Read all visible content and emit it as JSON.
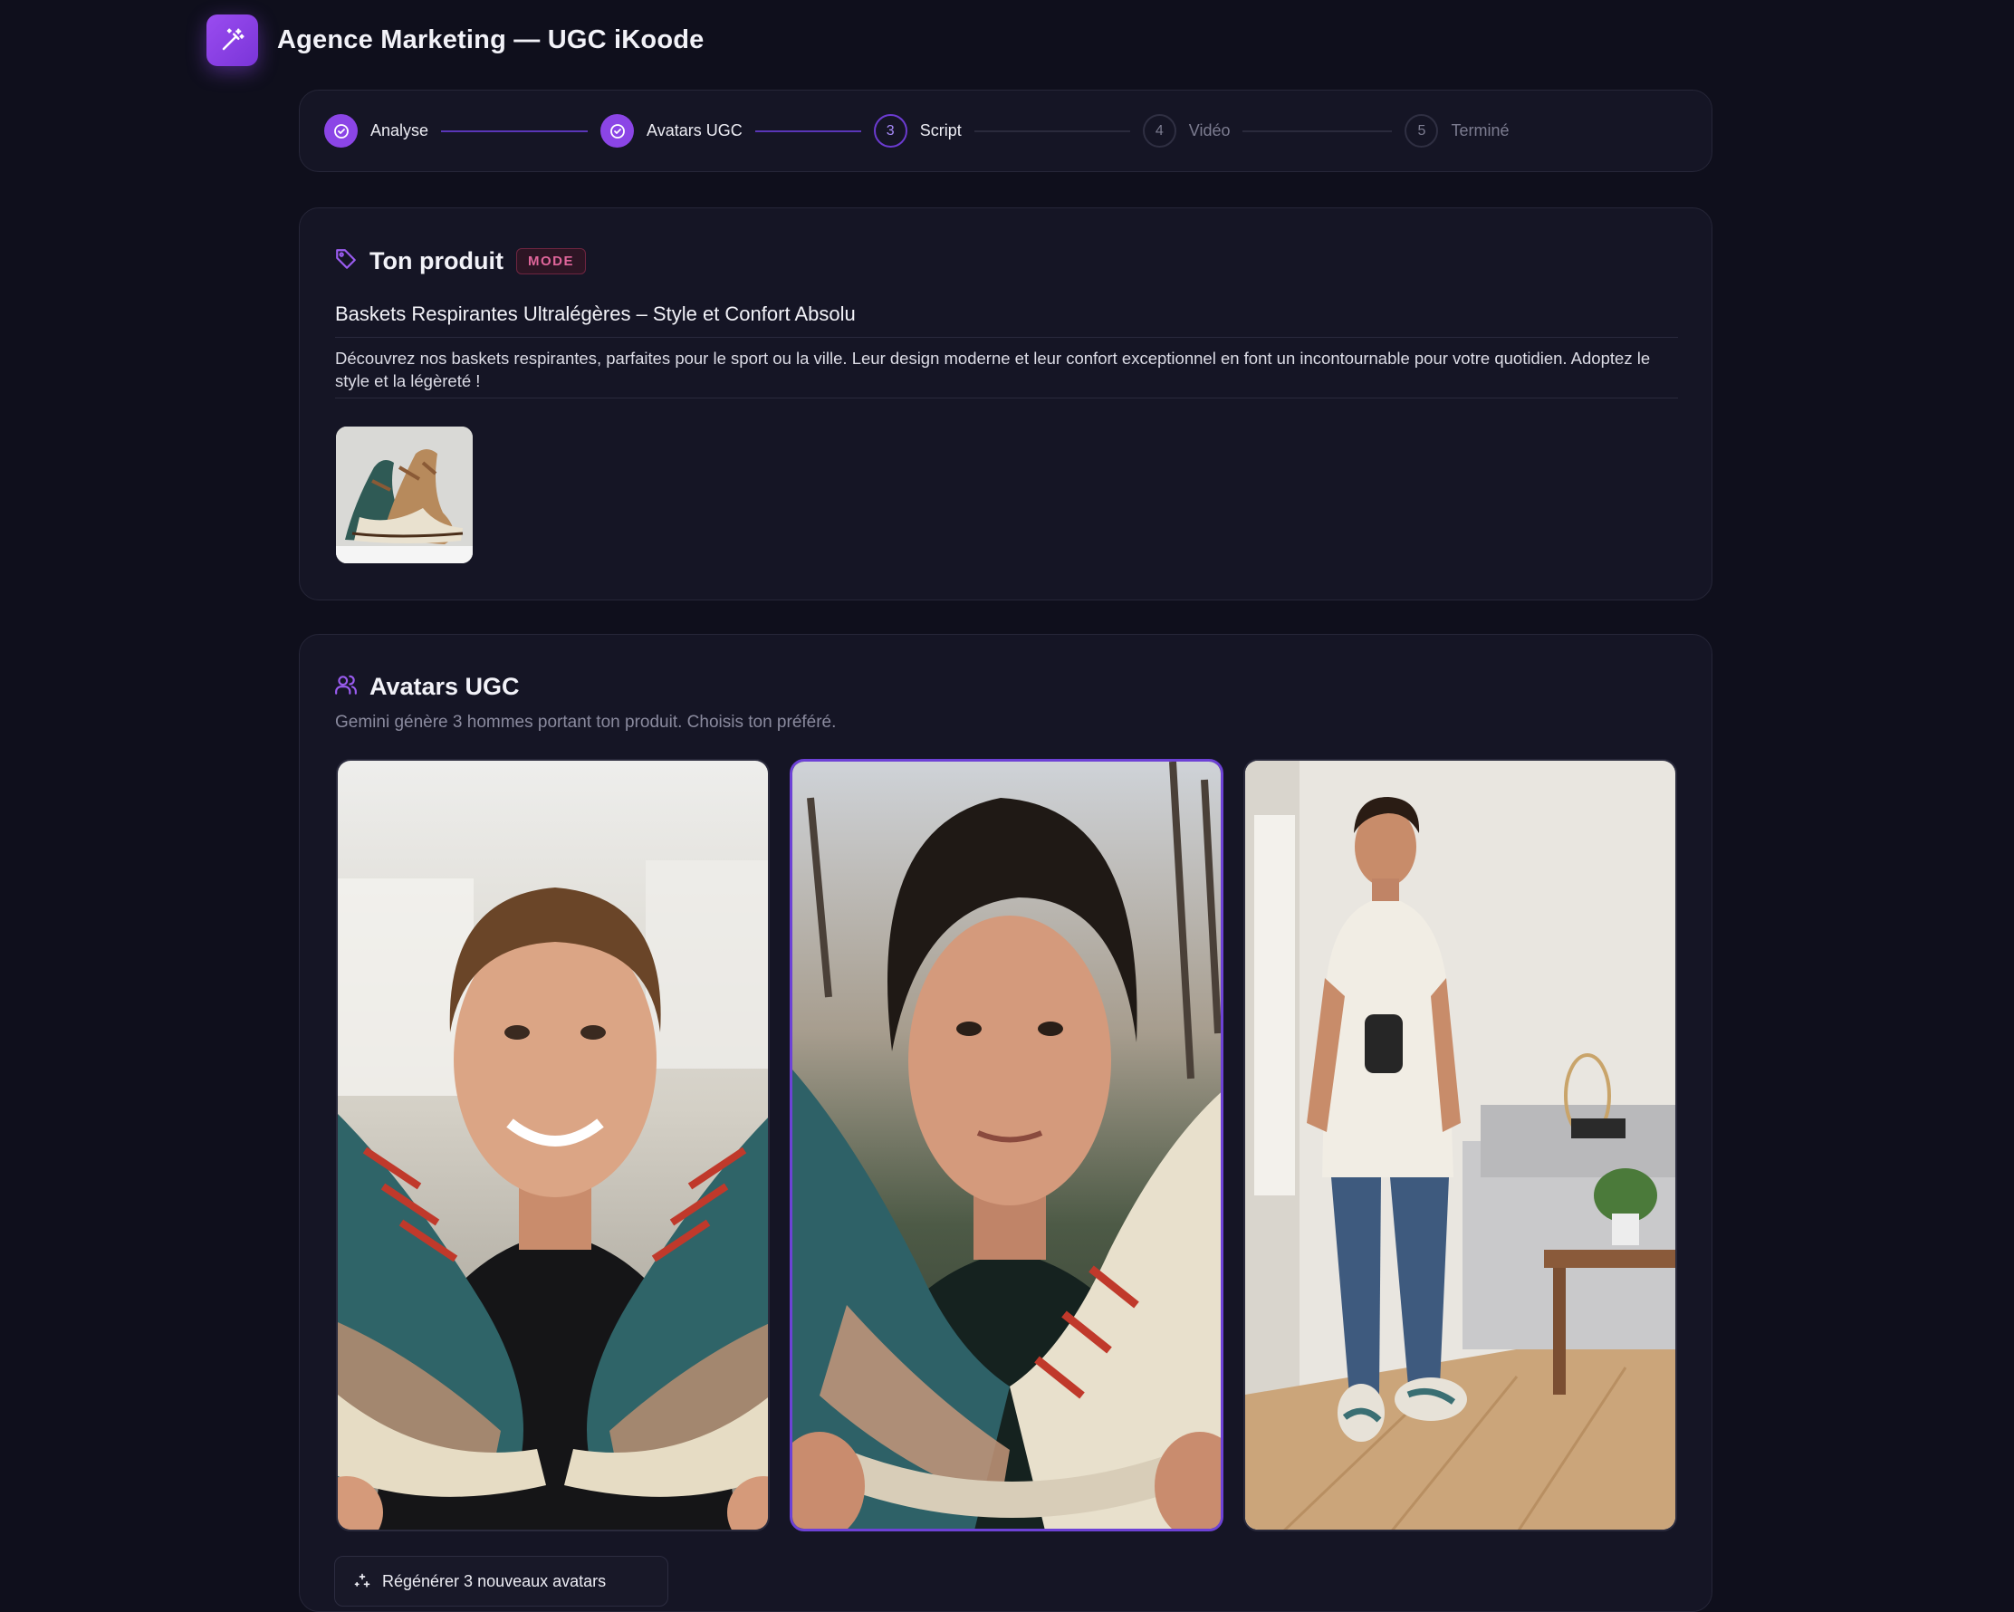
{
  "app": {
    "title": "Agence Marketing — UGC iKoode"
  },
  "stepper": {
    "steps": [
      {
        "number": "1",
        "label": "Analyse",
        "state": "done"
      },
      {
        "number": "2",
        "label": "Avatars UGC",
        "state": "done"
      },
      {
        "number": "3",
        "label": "Script",
        "state": "active"
      },
      {
        "number": "4",
        "label": "Vidéo",
        "state": "pending"
      },
      {
        "number": "5",
        "label": "Terminé",
        "state": "pending"
      }
    ]
  },
  "product": {
    "section_title": "Ton produit",
    "category_badge": "MODE",
    "name": "Baskets Respirantes Ultralégères – Style et Confort Absolu",
    "description": "Découvrez nos baskets respirantes, parfaites pour le sport ou la ville. Leur design moderne et leur confort exceptionnel en font un incontournable pour votre quotidien. Adoptez le style et la légèreté !"
  },
  "avatars": {
    "section_title": "Avatars UGC",
    "subtitle": "Gemini génère 3 hommes portant ton produit. Choisis ton préféré.",
    "selected_index": 1,
    "regenerate_label": "Régénérer 3 nouveaux avatars"
  },
  "colors": {
    "accent": "#8b45e6",
    "background": "#0f0f1c",
    "panel": "#151525",
    "badge": "#e0669b"
  }
}
